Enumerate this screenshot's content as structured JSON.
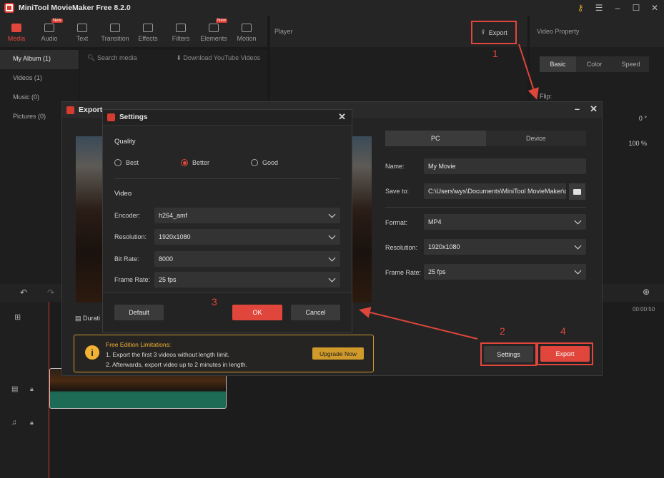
{
  "app": {
    "title": "MiniTool MovieMaker Free 8.2.0"
  },
  "media_tabs": [
    {
      "label": "Media",
      "new": false
    },
    {
      "label": "Audio",
      "new": true
    },
    {
      "label": "Text",
      "new": false
    },
    {
      "label": "Transition",
      "new": false
    },
    {
      "label": "Effects",
      "new": false
    },
    {
      "label": "Filters",
      "new": false
    },
    {
      "label": "Elements",
      "new": true
    },
    {
      "label": "Motion",
      "new": false
    }
  ],
  "new_badge": "New",
  "left_nav": [
    "My Album (1)",
    "Videos (1)",
    "Music (0)",
    "Pictures (0)"
  ],
  "media": {
    "search_placeholder": "Search media",
    "download_label": "Download YouTube Videos"
  },
  "player": {
    "label": "Player",
    "export_label": "Export"
  },
  "property": {
    "label": "Video Property",
    "tabs": [
      "Basic",
      "Color",
      "Speed"
    ],
    "flip_label": "Flip:",
    "rotate_value": "0 °",
    "scale_value": "100 %"
  },
  "timeline": {
    "time_end": "00:00:50"
  },
  "export_dialog": {
    "title": "Export",
    "duration_label": "Durati",
    "tabs": [
      "PC",
      "Device"
    ],
    "name_label": "Name:",
    "name_value": "My Movie",
    "save_label": "Save to:",
    "save_value": "C:\\Users\\wys\\Documents\\MiniTool MovieMaker\\ou",
    "format_label": "Format:",
    "format_value": "MP4",
    "resolution_label": "Resolution:",
    "resolution_value": "1920x1080",
    "framerate_label": "Frame Rate:",
    "framerate_value": "25 fps",
    "settings_button": "Settings",
    "export_button": "Export",
    "limits_title": "Free Edition Limitations:",
    "limits_line1": "1. Export the first 3 videos without length limit.",
    "limits_line2": "2. Afterwards, export video up to 2 minutes in length.",
    "upgrade_button": "Upgrade Now"
  },
  "settings_dialog": {
    "title": "Settings",
    "quality_label": "Quality",
    "quality_options": [
      "Best",
      "Better",
      "Good"
    ],
    "quality_selected": "Better",
    "video_label": "Video",
    "encoder_label": "Encoder:",
    "encoder_value": "h264_amf",
    "resolution_label": "Resolution:",
    "resolution_value": "1920x1080",
    "bitrate_label": "Bit Rate:",
    "bitrate_value": "8000",
    "framerate_label": "Frame Rate:",
    "framerate_value": "25 fps",
    "default_button": "Default",
    "ok_button": "OK",
    "cancel_button": "Cancel"
  },
  "annotations": [
    "1",
    "2",
    "3",
    "4"
  ],
  "colors": {
    "accent": "#e0463b",
    "warning": "#f2b233",
    "bg": "#1a1a1a"
  }
}
